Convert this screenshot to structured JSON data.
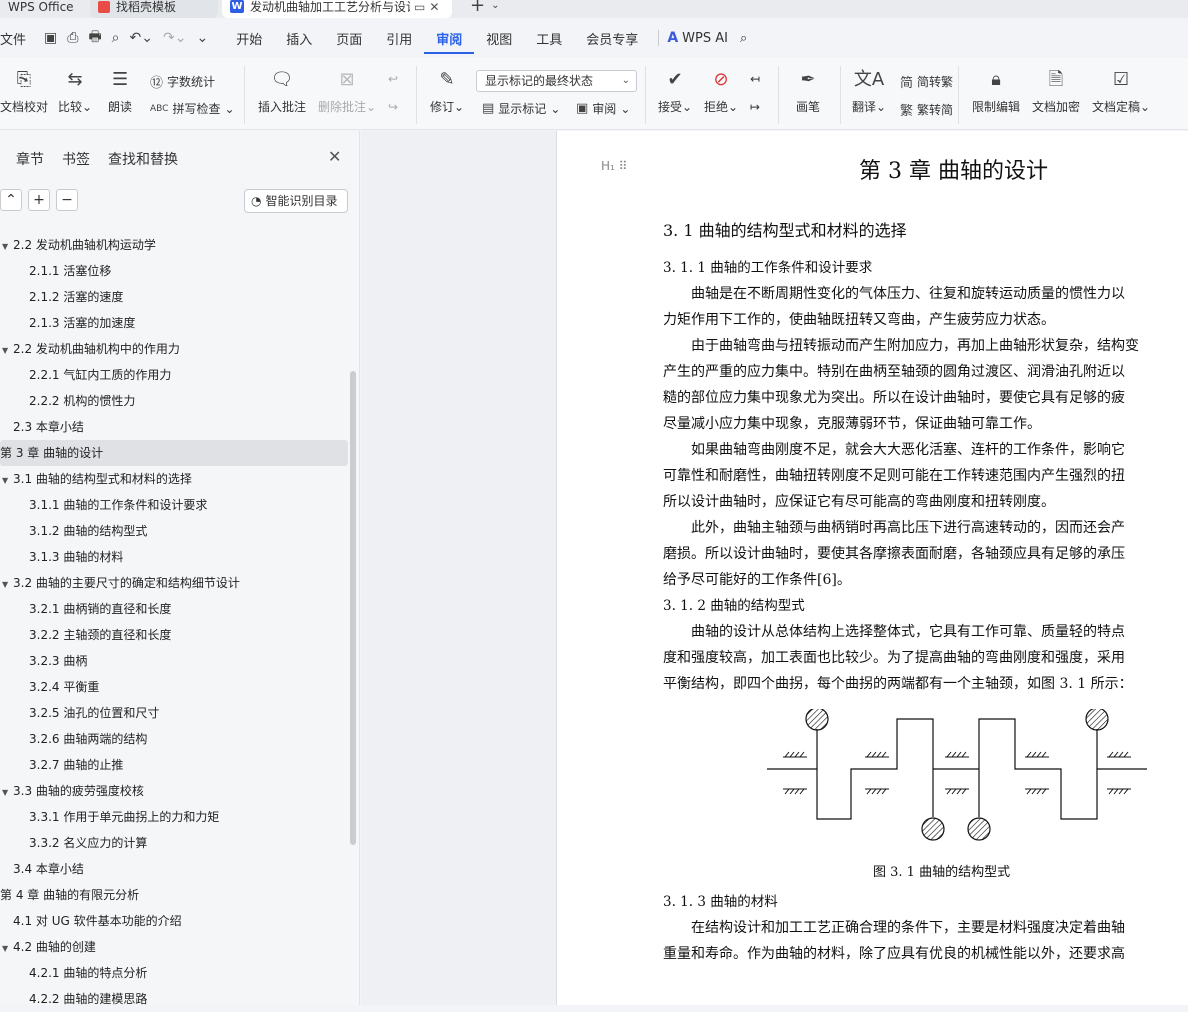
{
  "tabs": {
    "wps": "WPS Office",
    "template": "找稻壳模板",
    "document": "发动机曲轴加工工艺分析与设计",
    "plus": "+",
    "more": "⌄"
  },
  "menu": {
    "file": "文件",
    "items": [
      "开始",
      "插入",
      "页面",
      "引用",
      "审阅",
      "视图",
      "工具",
      "会员专享"
    ],
    "active": "审阅",
    "wps_ai": "WPS AI"
  },
  "ribbon": {
    "proof": "文档校对",
    "compare": "比较",
    "read_aloud": "朗读",
    "word_count": "字数统计",
    "spell_check": "拼写检查",
    "insert_comment": "插入批注",
    "delete_comment": "删除批注",
    "track_changes": "修订",
    "markup_select": "显示标记的最终状态",
    "show_markup": "显示标记",
    "review": "审阅",
    "accept": "接受",
    "reject": "拒绝",
    "pen": "画笔",
    "translate": "翻译",
    "to_traditional": "简转繁",
    "to_simplified": "繁转简",
    "restrict_edit": "限制编辑",
    "encrypt": "文档加密",
    "finalize": "文档定稿"
  },
  "nav": {
    "tabs": [
      "章节",
      "书签",
      "查找和替换"
    ],
    "smart_toc": "智能识别目录",
    "toc": [
      {
        "text": "2.2 发动机曲轴机构运动学",
        "level": 1,
        "tw": "▼"
      },
      {
        "text": "2.1.1 活塞位移",
        "level": 2
      },
      {
        "text": "2.1.2 活塞的速度",
        "level": 2
      },
      {
        "text": "2.1.3 活塞的加速度",
        "level": 2
      },
      {
        "text": "2.2 发动机曲轴机构中的作用力",
        "level": 1,
        "tw": "▼"
      },
      {
        "text": "2.2.1 气缸内工质的作用力",
        "level": 2
      },
      {
        "text": "2.2.2 机构的惯性力",
        "level": 2
      },
      {
        "text": "2.3 本章小结",
        "level": 1
      },
      {
        "text": "第 3 章 曲轴的设计",
        "level": 0,
        "selected": true
      },
      {
        "text": "3.1 曲轴的结构型式和材料的选择",
        "level": 1,
        "tw": "▼"
      },
      {
        "text": "3.1.1 曲轴的工作条件和设计要求",
        "level": 2
      },
      {
        "text": "3.1.2 曲轴的结构型式",
        "level": 2
      },
      {
        "text": "3.1.3 曲轴的材料",
        "level": 2
      },
      {
        "text": "3.2 曲轴的主要尺寸的确定和结构细节设计",
        "level": 1,
        "tw": "▼"
      },
      {
        "text": "3.2.1 曲柄销的直径和长度",
        "level": 2
      },
      {
        "text": "3.2.2 主轴颈的直径和长度",
        "level": 2
      },
      {
        "text": "3.2.3 曲柄",
        "level": 2
      },
      {
        "text": "3.2.4 平衡重",
        "level": 2
      },
      {
        "text": "3.2.5 油孔的位置和尺寸",
        "level": 2
      },
      {
        "text": "3.2.6 曲轴两端的结构",
        "level": 2
      },
      {
        "text": "3.2.7 曲轴的止推",
        "level": 2
      },
      {
        "text": "3.3 曲轴的疲劳强度校核",
        "level": 1,
        "tw": "▼"
      },
      {
        "text": "3.3.1 作用于单元曲拐上的力和力矩",
        "level": 2
      },
      {
        "text": "3.3.2 名义应力的计算",
        "level": 2
      },
      {
        "text": "3.4 本章小结",
        "level": 1
      },
      {
        "text": "第 4 章 曲轴的有限元分析",
        "level": 0
      },
      {
        "text": "4.1 对 UG 软件基本功能的介绍",
        "level": 1
      },
      {
        "text": "4.2 曲轴的创建",
        "level": 1,
        "tw": "▼"
      },
      {
        "text": "4.2.1 曲轴的特点分析",
        "level": 2
      },
      {
        "text": "4.2.2 曲轴的建模思路",
        "level": 2
      }
    ]
  },
  "doc": {
    "chapter_title": "第 3 章  曲轴的设计",
    "s31": "3. 1  曲轴的结构型式和材料的选择",
    "s311": "3. 1. 1  曲轴的工作条件和设计要求",
    "p1": [
      "　　曲轴是在不断周期性变化的气体压力、往复和旋转运动质量的惯性力以",
      "力矩作用下工作的，使曲轴既扭转又弯曲，产生疲劳应力状态。"
    ],
    "p2": [
      "　　由于曲轴弯曲与扭转振动而产生附加应力，再加上曲轴形状复杂，结构变",
      "产生的严重的应力集中。特别在曲柄至轴颈的圆角过渡区、润滑油孔附近以",
      "糙的部位应力集中现象尤为突出。所以在设计曲轴时，要使它具有足够的疲",
      "尽量减小应力集中现象，克服薄弱环节，保证曲轴可靠工作。"
    ],
    "p3": [
      "　　如果曲轴弯曲刚度不足，就会大大恶化活塞、连杆的工作条件，影响它",
      "可靠性和耐磨性，曲轴扭转刚度不足则可能在工作转速范围内产生强烈的扭",
      "所以设计曲轴时，应保证它有尽可能高的弯曲刚度和扭转刚度。"
    ],
    "p4": [
      "　　此外，曲轴主轴颈与曲柄销时再高比压下进行高速转动的，因而还会产",
      "磨损。所以设计曲轴时，要使其各摩擦表面耐磨，各轴颈应具有足够的承压",
      "给予尽可能好的工作条件[6]。"
    ],
    "s312": "3. 1. 2  曲轴的结构型式",
    "p5": [
      "　　曲轴的设计从总体结构上选择整体式，它具有工作可靠、质量轻的特点",
      "度和强度较高，加工表面也比较少。为了提高曲轴的弯曲刚度和强度，采用",
      "平衡结构，即四个曲拐，每个曲拐的两端都有一个主轴颈，如图 3. 1 所示："
    ],
    "fig_caption": "图 3. 1  曲轴的结构型式",
    "s313": "3. 1. 3  曲轴的材料",
    "p6": [
      "　　在结构设计和加工工艺正确合理的条件下，主要是材料强度决定着曲轴",
      "重量和寿命。作为曲轴的材料，除了应具有优良的机械性能以外，还要求高"
    ]
  }
}
